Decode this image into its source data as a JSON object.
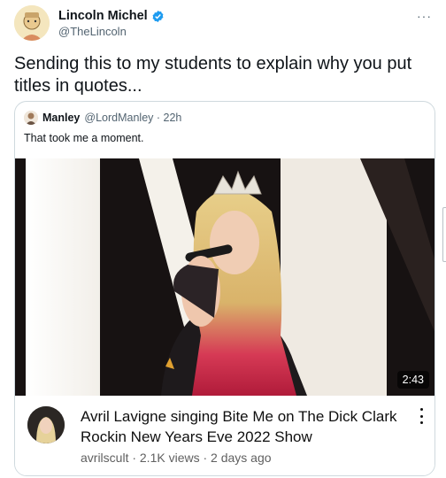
{
  "author": {
    "display_name": "Lincoln Michel",
    "handle": "@TheLincoln",
    "verified_icon": "verified-badge-icon"
  },
  "tweet": {
    "text": "Sending this to my students to explain why you put titles in quotes..."
  },
  "quoted_tweet": {
    "name": "Manley",
    "handle_time": "@LordManley · 22h",
    "text": "That took me a moment."
  },
  "video": {
    "duration": "2:43"
  },
  "youtube_card": {
    "title": "Avril Lavigne singing Bite Me on The Dick Clark Rockin New Years Eve 2022 Show",
    "meta": "avrilscult · 2.1K views · 2 days ago"
  },
  "colors": {
    "verified": "#1d9bf0",
    "secondary_text": "#536471",
    "border": "#cfd9de"
  }
}
